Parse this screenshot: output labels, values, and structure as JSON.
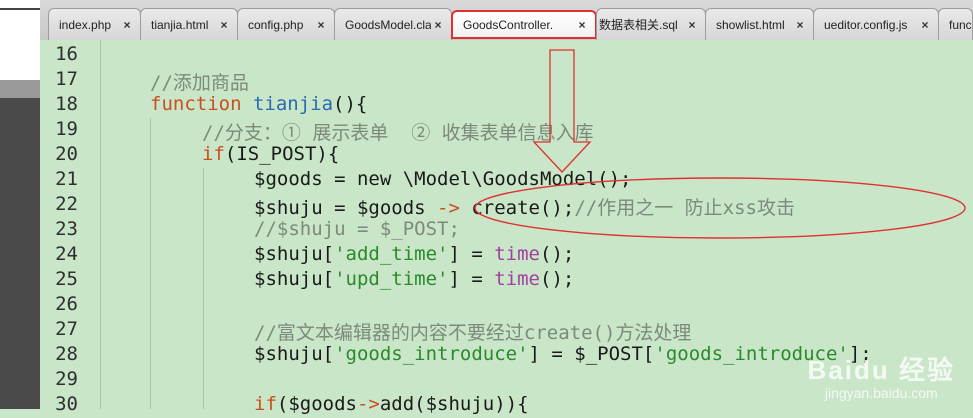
{
  "tabs": [
    {
      "label": "index.php",
      "close": "×"
    },
    {
      "label": "tianjia.html",
      "close": "×"
    },
    {
      "label": "config.php",
      "close": "×"
    },
    {
      "label": "GoodsModel.clas",
      "close": "×"
    },
    {
      "label": "GoodsController.",
      "close": "×",
      "active": true
    },
    {
      "label": "数据表相关.sql",
      "close": "×"
    },
    {
      "label": "showlist.html",
      "close": "×"
    },
    {
      "label": "ueditor.config.js",
      "close": "×"
    },
    {
      "label": "func",
      "close": ""
    }
  ],
  "editor": {
    "line_numbers": [
      "16",
      "17",
      "18",
      "19",
      "20",
      "21",
      "22",
      "23",
      "24",
      "25",
      "26",
      "27",
      "28",
      "29",
      "30"
    ],
    "code": {
      "l17": "//添加商品",
      "l18_kw": "function",
      "l18_fn": "tianjia",
      "l18_rest": "(){",
      "l19": "//分支：① 展示表单  ② 收集表单信息入库",
      "l20_kw": "if",
      "l20_rest": "(IS_POST){",
      "l21_a": "$goods = ",
      "l21_kw": "new",
      "l21_b": " \\Model\\GoodsModel();",
      "l22_a": "$shuju = $goods ",
      "l22_arrow": "->",
      "l22_b": " create();",
      "l22_cm": "//作用之一 防止xss攻击",
      "l23": "//$shuju = $_POST;",
      "l24_a": "$shuju[",
      "l24_str": "'add_time'",
      "l24_b": "] = ",
      "l24_fn": "time",
      "l24_c": "();",
      "l25_a": "$shuju[",
      "l25_str": "'upd_time'",
      "l25_b": "] = ",
      "l25_fn": "time",
      "l25_c": "();",
      "l27": "//富文本编辑器的内容不要经过create()方法处理",
      "l28_a": "$shuju[",
      "l28_str": "'goods_introduce'",
      "l28_b": "] = $_POST[",
      "l28_str2": "'goods_introduce'",
      "l28_c": "];",
      "l30_kw": "if",
      "l30_a": "($goods",
      "l30_arrow": "->",
      "l30_b": "add($shuju)){"
    }
  },
  "watermark": {
    "brand": "Baidu 经验",
    "url": "jingyan.baidu.com"
  },
  "colors": {
    "editor_bg": "#c9e6c9",
    "annotation": "#e03030",
    "keyword": "#c8501e",
    "string": "#2a8a2a",
    "comment": "#7c8a7c"
  }
}
